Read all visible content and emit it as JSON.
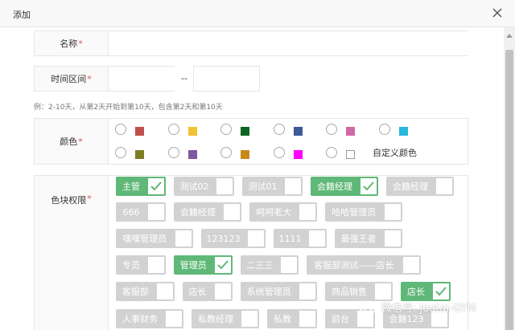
{
  "dialog": {
    "title": "添加",
    "close_icon": "close-icon"
  },
  "form": {
    "name": {
      "label": "名称",
      "required": "*",
      "value": ""
    },
    "time_range": {
      "label": "时间区间",
      "required": "*",
      "start": "",
      "separator": "--",
      "end": ""
    },
    "hint": "例：2-10天，从第2天开始到第10天，包含第2天和第10天",
    "color": {
      "label": "颜色",
      "required": "*",
      "options": [
        "#c0504d",
        "#f1c232",
        "#0b6623",
        "#3d5a99",
        "#d068a3",
        "#29b6e0",
        "#7d7d23",
        "#7e57a0",
        "#c8891a",
        "#ff00ff",
        "#ffffff"
      ],
      "custom_label": "自定义颜色"
    },
    "permissions": {
      "label": "色块权限",
      "required": "*",
      "roles": [
        {
          "name": "主管",
          "on": true
        },
        {
          "name": "测试02",
          "on": false
        },
        {
          "name": "测试01",
          "on": false
        },
        {
          "name": "会籍经理",
          "on": true
        },
        {
          "name": "会籍经理",
          "on": false
        },
        {
          "name": "666",
          "on": false
        },
        {
          "name": "会籍经理",
          "on": false
        },
        {
          "name": "呵呵老大",
          "on": false
        },
        {
          "name": "哈哈管理员",
          "on": false
        },
        {
          "name": "嘿嘿管理员",
          "on": false
        },
        {
          "name": "123123",
          "on": false
        },
        {
          "name": "1111",
          "on": false
        },
        {
          "name": "最强王者",
          "on": false
        },
        {
          "name": "专员",
          "on": false
        },
        {
          "name": "管理员",
          "on": true
        },
        {
          "name": "二三三",
          "on": false
        },
        {
          "name": "客服部测试——店长",
          "on": false
        },
        {
          "name": "客服部",
          "on": false
        },
        {
          "name": "店长",
          "on": false
        },
        {
          "name": "系统管理员",
          "on": false
        },
        {
          "name": "商品销售",
          "on": false
        },
        {
          "name": "店长",
          "on": true
        },
        {
          "name": "人事财务",
          "on": false
        },
        {
          "name": "私教经理",
          "on": false
        },
        {
          "name": "私教",
          "on": false
        },
        {
          "name": "前台",
          "on": false
        },
        {
          "name": "会籍123",
          "on": false
        }
      ]
    }
  },
  "watermark": {
    "text": "微信号: Jootai-GYM"
  },
  "colors": {
    "accent_green": "#5fb878",
    "toggle_off": "#d2d2d2",
    "required_red": "#d9534f"
  }
}
